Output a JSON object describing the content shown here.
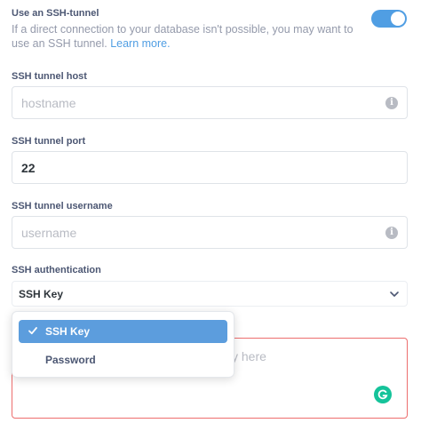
{
  "ssh_tunnel": {
    "title": "Use an SSH-tunnel",
    "description": "If a direct connection to your database isn't possible, you may want to use an SSH tunnel.",
    "learn_more": "Learn more.",
    "enabled": true
  },
  "host": {
    "label": "SSH tunnel host",
    "placeholder": "hostname",
    "value": ""
  },
  "port": {
    "label": "SSH tunnel port",
    "value": "22"
  },
  "username": {
    "label": "SSH tunnel username",
    "placeholder": "username",
    "value": ""
  },
  "auth": {
    "label": "SSH authentication",
    "selected": "SSH Key",
    "options": [
      "SSH Key",
      "Password"
    ]
  },
  "private_key": {
    "placeholder_visible": "y here"
  },
  "colors": {
    "accent": "#509ee3",
    "error": "#ed6e6e",
    "grammarly": "#15c39a"
  },
  "icons": [
    "info-icon",
    "chevron-down-icon",
    "checkmark-icon",
    "grammarly-icon"
  ]
}
